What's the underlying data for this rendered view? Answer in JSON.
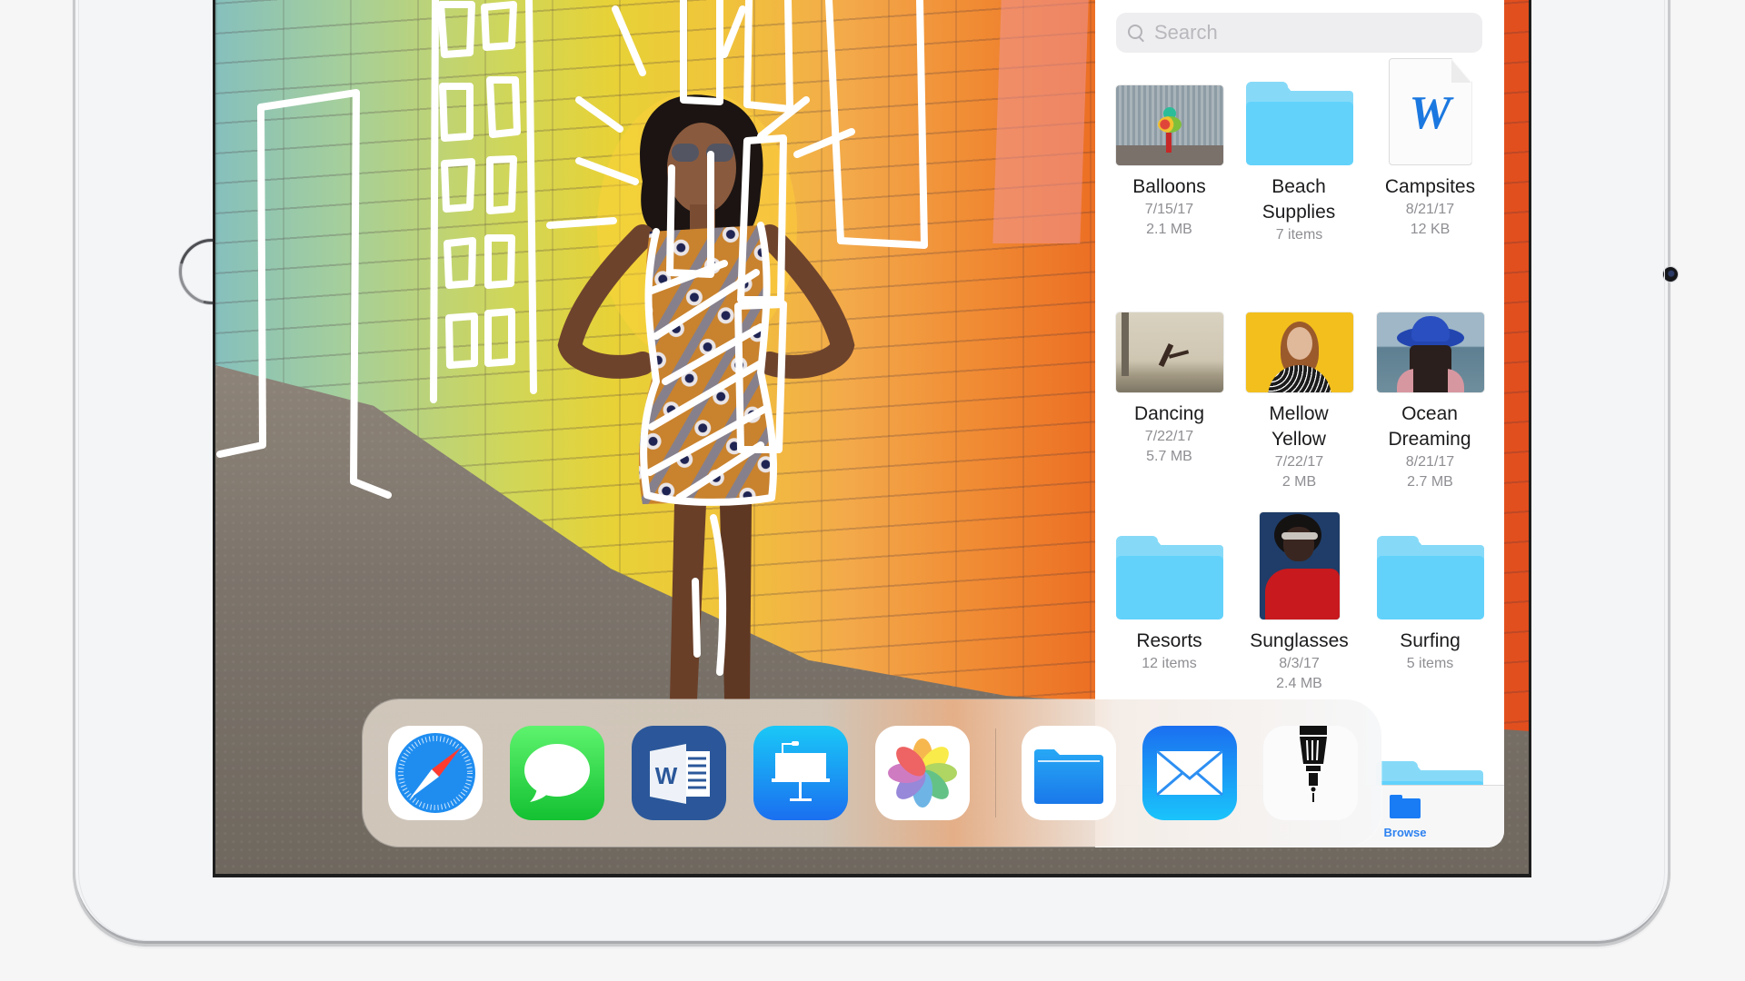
{
  "files": {
    "search": {
      "placeholder": "Search",
      "value": ""
    },
    "items": [
      {
        "name": "Balloons",
        "line1": "7/15/17",
        "line2": "2.1 MB",
        "kind": "photo",
        "icon": "balloons-thumbnail"
      },
      {
        "name": "Beach Supplies",
        "line1": "7 items",
        "line2": "",
        "kind": "folder",
        "icon": "folder-icon"
      },
      {
        "name": "Campsites",
        "line1": "8/21/17",
        "line2": "12 KB",
        "kind": "document",
        "icon": "word-document-icon",
        "doc_letter": "W"
      },
      {
        "name": "Dancing",
        "line1": "7/22/17",
        "line2": "5.7 MB",
        "kind": "photo",
        "icon": "dancing-thumbnail"
      },
      {
        "name": "Mellow Yellow",
        "line1": "7/22/17",
        "line2": "2 MB",
        "kind": "photo",
        "icon": "mellow-yellow-thumbnail"
      },
      {
        "name": "Ocean Dreaming",
        "line1": "8/21/17",
        "line2": "2.7 MB",
        "kind": "photo",
        "icon": "ocean-dreaming-thumbnail"
      },
      {
        "name": "Resorts",
        "line1": "12 items",
        "line2": "",
        "kind": "folder",
        "icon": "folder-icon"
      },
      {
        "name": "Sunglasses",
        "line1": "8/3/17",
        "line2": "2.4 MB",
        "kind": "photo",
        "icon": "sunglasses-thumbnail"
      },
      {
        "name": "Surfing",
        "line1": "5 items",
        "line2": "",
        "kind": "folder",
        "icon": "folder-icon"
      }
    ],
    "tab_bar": {
      "browse_label": "Browse",
      "selected": "Browse"
    }
  },
  "dock": {
    "apps": [
      {
        "name": "Safari",
        "icon": "safari-icon"
      },
      {
        "name": "Messages",
        "icon": "messages-icon"
      },
      {
        "name": "Microsoft Word",
        "icon": "word-icon",
        "letter": "W"
      },
      {
        "name": "Keynote",
        "icon": "keynote-icon"
      },
      {
        "name": "Photos",
        "icon": "photos-icon"
      }
    ],
    "recent_apps": [
      {
        "name": "Files",
        "icon": "files-icon"
      },
      {
        "name": "Mail",
        "icon": "mail-icon"
      },
      {
        "name": "Markup Pen",
        "icon": "pen-tool-icon"
      }
    ]
  },
  "colors": {
    "accent": "#1a7cf5",
    "folder": "#62d2fb",
    "bezel": "#f4f5f7"
  }
}
